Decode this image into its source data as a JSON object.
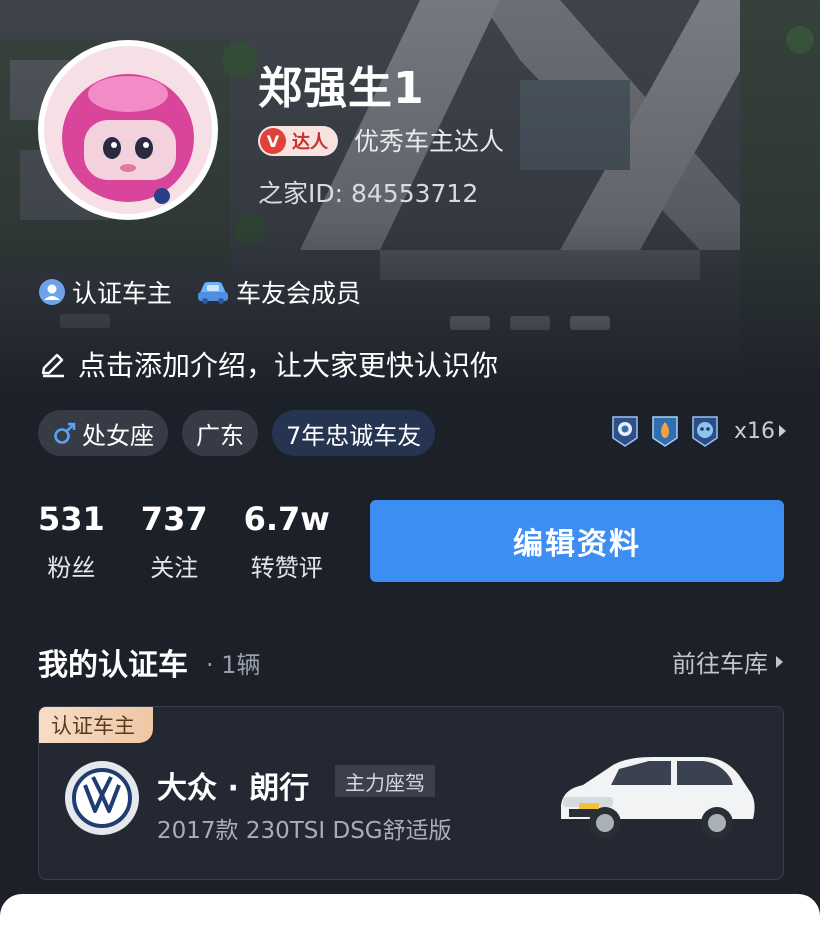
{
  "profile": {
    "username": "郑强生1",
    "vip_badge": "达人",
    "vip_badge_mark": "V",
    "vip_title": "优秀车主达人",
    "home_id": "之家ID: 84553712"
  },
  "certifications": [
    {
      "label": "认证车主",
      "icon": "person-verified-icon"
    },
    {
      "label": "车友会成员",
      "icon": "car-icon"
    }
  ],
  "intro_prompt": "点击添加介绍，让大家更快认识你",
  "tags": {
    "zodiac": "处女座",
    "region": "广东",
    "loyalty": "7年忠诚车友"
  },
  "medals": {
    "count_label": "x16",
    "icons": [
      "medal-astronaut-icon",
      "medal-flame-icon",
      "medal-robot-icon"
    ]
  },
  "stats": [
    {
      "value": "531",
      "label": "粉丝"
    },
    {
      "value": "737",
      "label": "关注"
    },
    {
      "value": "6.7w",
      "label": "转赞评"
    }
  ],
  "edit_button": "编辑资料",
  "certified_cars": {
    "title": "我的认证车",
    "count": "· 1辆",
    "garage_link": "前往车库",
    "car": {
      "ribbon": "认证车主",
      "brand_model": "大众 · 朗行",
      "driver_tag": "主力座驾",
      "spec": "2017款 230TSI DSG舒适版",
      "logo": "volkswagen-logo"
    }
  },
  "colors": {
    "background": "#1c2029",
    "accent_blue": "#3d8ef2",
    "badge_red": "#e0413a",
    "ribbon_gold": "#f6ddc6"
  }
}
